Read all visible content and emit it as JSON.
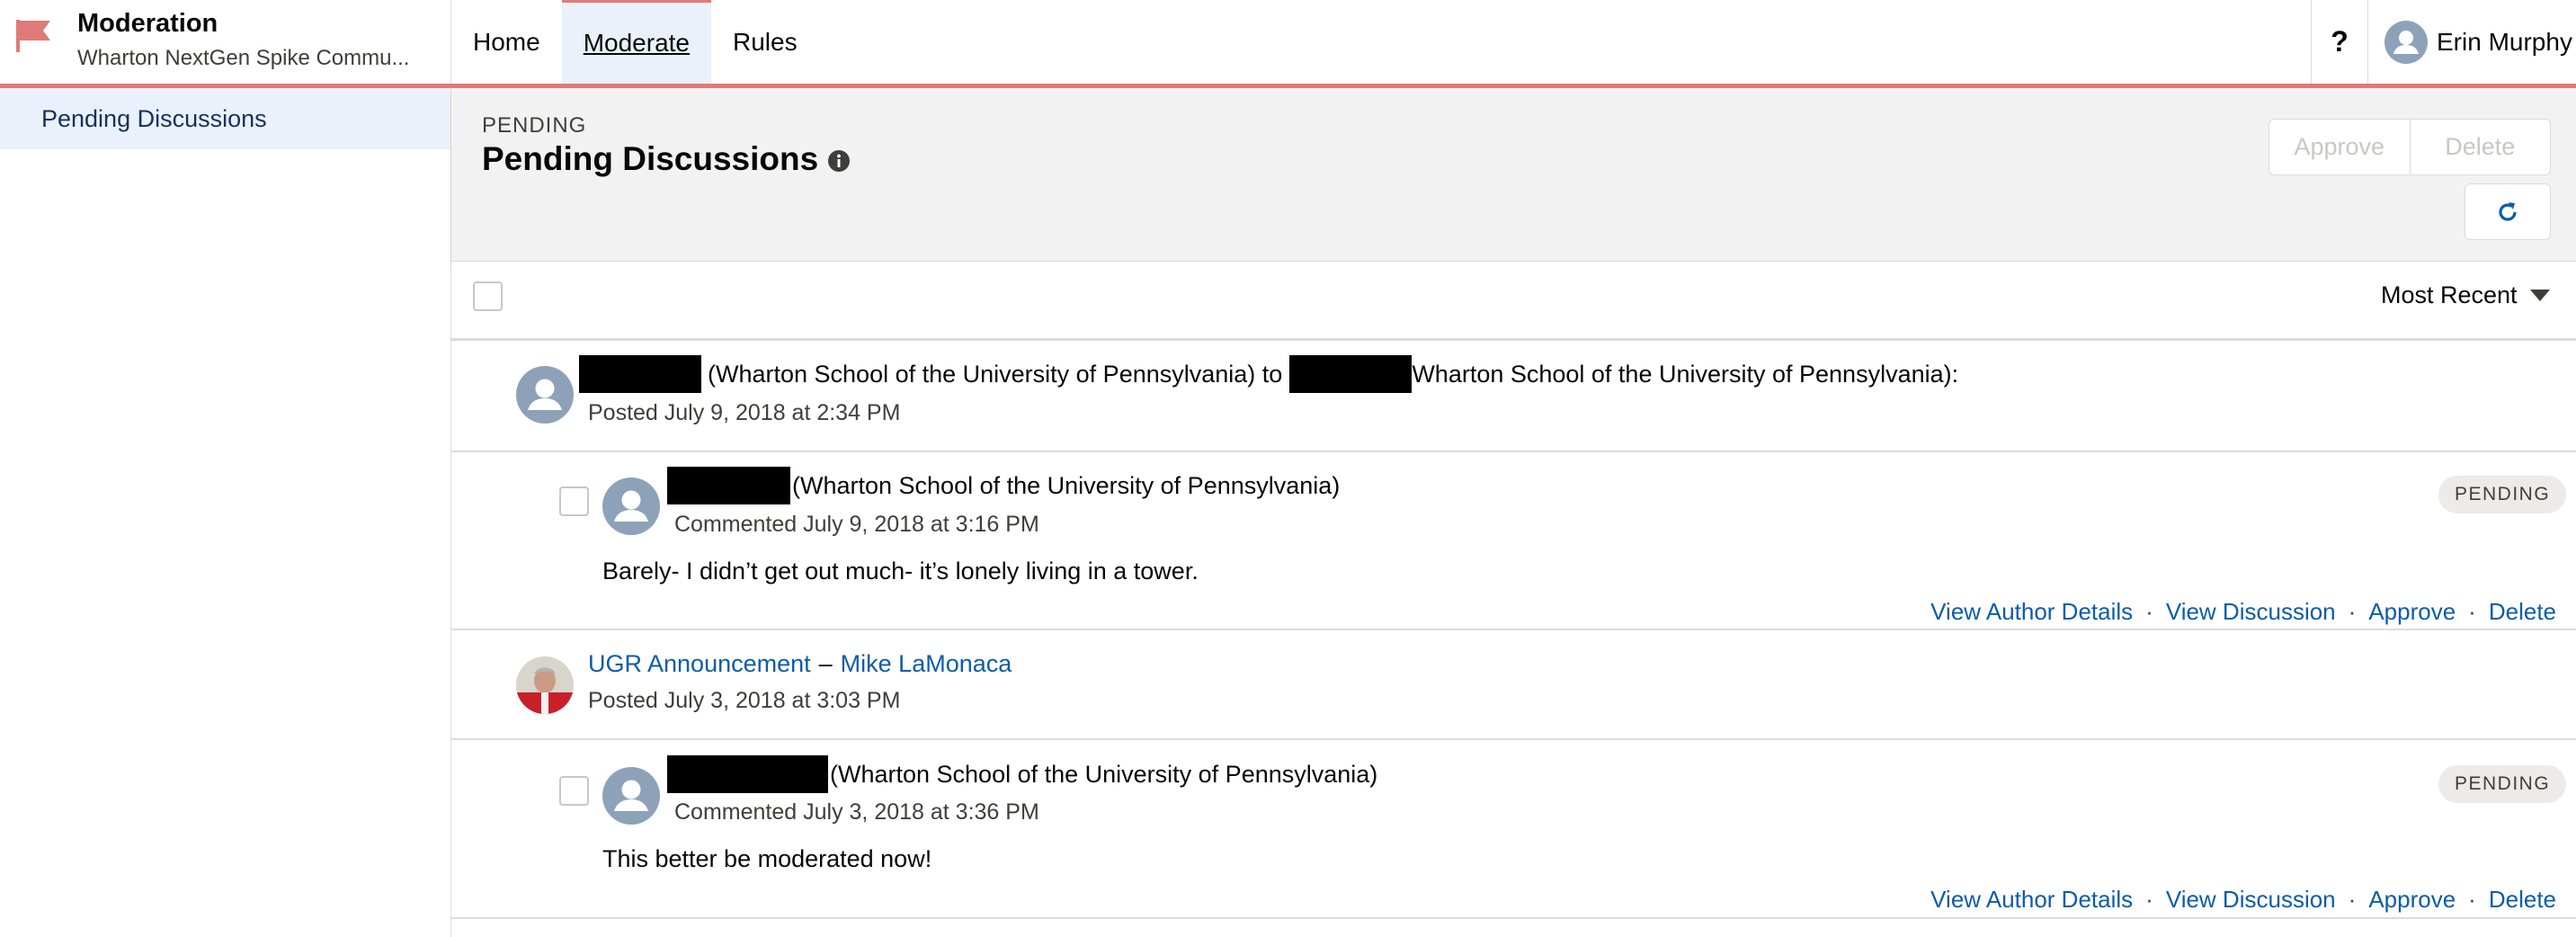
{
  "app": {
    "title": "Moderation",
    "subtitle": "Wharton NextGen Spike Commu...",
    "nav_tabs": [
      {
        "label": "Home"
      },
      {
        "label": "Moderate"
      },
      {
        "label": "Rules"
      }
    ],
    "help_label": "?",
    "user_name": "Erin Murphy"
  },
  "sidebar": {
    "items": [
      {
        "label": "Pending Discussions"
      }
    ]
  },
  "page_header": {
    "eyebrow": "PENDING",
    "title": "Pending Discussions",
    "approve_label": "Approve",
    "delete_label": "Delete"
  },
  "toolbar": {
    "sort_label": "Most Recent"
  },
  "feed": [
    {
      "type": "post",
      "text_1": "(Wharton School of the University of Pennsylvania) to",
      "text_2": "Wharton School of the University of Pennsylvania):",
      "posted": "Posted July 9, 2018 at 2:34 PM"
    },
    {
      "type": "comment",
      "org": "(Wharton School of the University of Pennsylvania)",
      "commented": "Commented July 9, 2018 at 3:16 PM",
      "body": "Barely- I didn’t get out much- it’s lonely living in a tower.",
      "badge": "PENDING",
      "actions": [
        "View Author Details",
        "View Discussion",
        "Approve",
        "Delete"
      ]
    },
    {
      "type": "post",
      "group": "UGR Announcement",
      "separator": "–",
      "author": "Mike LaMonaca",
      "posted": "Posted July 3, 2018 at 3:03 PM"
    },
    {
      "type": "comment",
      "org": "(Wharton School of the University of Pennsylvania)",
      "commented": "Commented July 3, 2018 at 3:36 PM",
      "body": "This better be moderated now!",
      "badge": "PENDING",
      "actions": [
        "View Author Details",
        "View Discussion",
        "Approve",
        "Delete"
      ]
    }
  ],
  "colors": {
    "accent": "#e07a78",
    "link": "#0b5cab",
    "active_bg": "#eaf1fb",
    "header_bg": "#f3f2f2"
  },
  "icons": [
    "flag-icon",
    "user-icon",
    "info-icon",
    "refresh-icon",
    "caret-down-icon"
  ]
}
